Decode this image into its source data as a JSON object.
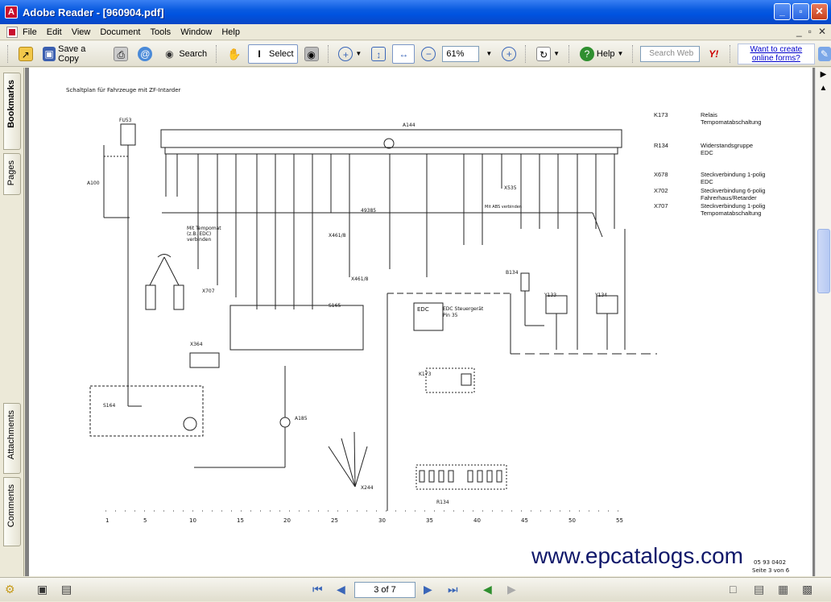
{
  "window": {
    "title": "Adobe Reader - [960904.pdf]",
    "controls": [
      "_",
      "▫",
      "✕"
    ]
  },
  "menubar": {
    "items": [
      "File",
      "Edit",
      "View",
      "Document",
      "Tools",
      "Window",
      "Help"
    ],
    "right_controls": [
      "_",
      "▫",
      "✕"
    ]
  },
  "toolbar": {
    "save_label": "Save a Copy",
    "search_label": "Search",
    "select_label": "Select",
    "zoom_value": "61%",
    "help_label": "Help",
    "search_web_placeholder": "Search Web",
    "forms_link": "Want to create online forms?"
  },
  "sidebar": {
    "tabs": [
      "Bookmarks",
      "Pages",
      "Attachments",
      "Comments"
    ]
  },
  "document": {
    "heading": "Schaltplan für Fahrzeuge mit ZF-Intarder",
    "legend": [
      {
        "code": "K173",
        "desc1": "Relais",
        "desc2": "Tempomatabschaltung",
        "desc3": ""
      },
      {
        "code": "R134",
        "desc1": "Widerstandsgruppe",
        "desc2": "EDC",
        "desc3": ""
      },
      {
        "code": "X678",
        "desc1": "Steckverbindung 1-polig",
        "desc2": "EDC",
        "desc3": ""
      },
      {
        "code": "X702",
        "desc1": "Steckverbindung 6-polig",
        "desc2": "Fahrerhaus/Retarder",
        "desc3": ""
      },
      {
        "code": "X707",
        "desc1": "Steckverbindung 1-polig",
        "desc2": "Tempomatabschaltung",
        "desc3": ""
      }
    ],
    "components": {
      "a144": "A144",
      "fu53": "FU53",
      "a100": "A100",
      "x707": "X707",
      "s165": "S165",
      "x364": "X364",
      "s164": "S164",
      "a185": "A185",
      "x244": "X244",
      "edc_title": "EDC",
      "edc_desc": "EDC Steuergerät",
      "edc_pin": "Pin 35",
      "k173": "K173",
      "r134": "R134",
      "b134": "B134",
      "y133": "Y133",
      "y134": "Y134",
      "x535": "X535",
      "x461_a": "X461/8",
      "x461_b": "X461/8",
      "tempomat_note1": "Mit Tempomat",
      "tempomat_note2": "(z.B. EDC)",
      "tempomat_note3": "verbinden",
      "abs_note": "Mit ABS verbinden",
      "wire_49385": "49385"
    },
    "scale_ticks": [
      "1",
      "5",
      "10",
      "15",
      "20",
      "25",
      "30",
      "35",
      "40",
      "45",
      "50",
      "55"
    ],
    "footer_page": "Seite 3 von 6",
    "footer_code": "05 93 0402",
    "watermark": "www.epcatalogs.com"
  },
  "statusbar": {
    "page_field": "3 of 7"
  }
}
